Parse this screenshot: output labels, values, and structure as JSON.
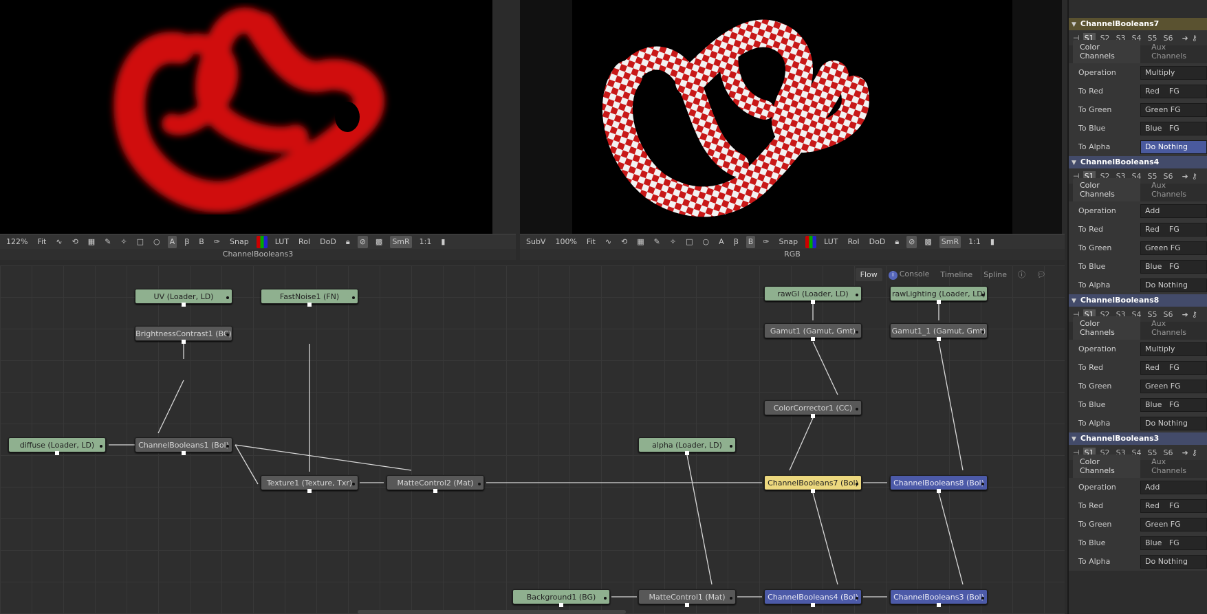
{
  "left_viewer": {
    "zoom": "122%",
    "fit": "Fit",
    "snap": "Snap",
    "lut": "LUT",
    "roi": "RoI",
    "dod": "DoD",
    "smr": "SmR",
    "ratio": "1:1",
    "label": "ChannelBooleans3"
  },
  "right_viewer": {
    "subv": "SubV",
    "zoom": "100%",
    "fit": "Fit",
    "snap": "Snap",
    "lut": "LUT",
    "roi": "RoI",
    "dod": "DoD",
    "smr": "SmR",
    "ratio": "1:1",
    "label": "RGB"
  },
  "flow_tabs": [
    "Flow",
    "Console",
    "Timeline",
    "Spline"
  ],
  "nodes": {
    "uv": "UV  (Loader, LD)",
    "fastnoise": "FastNoise1  (FN)",
    "brightness": "BrightnessContrast1  (BC)",
    "diffuse": "diffuse  (Loader, LD)",
    "cb1": "ChannelBooleans1  (Bol)",
    "texture": "Texture1  (Texture, Txr)",
    "matte2": "MatteControl2  (Mat)",
    "rawgi": "rawGI  (Loader, LD)",
    "rawlighting": "rawLighting  (Loader, LD)",
    "gamut1": "Gamut1  (Gamut, Gmt)",
    "gamut1_1": "Gamut1_1  (Gamut, Gmt)",
    "cc1": "ColorCorrector1  (CC)",
    "alpha": "alpha  (Loader, LD)",
    "cb7": "ChannelBooleans7  (Bol)",
    "cb8": "ChannelBooleans8  (Bol)",
    "bg": "Background1  (BG)",
    "matte1": "MatteControl1  (Mat)",
    "cb4": "ChannelBooleans4  (Bol)",
    "cb3": "ChannelBooleans3  (Bol)"
  },
  "panel": {
    "sections": [
      {
        "title": "ChannelBooleans7",
        "active": true,
        "operation": "Multiply",
        "to_red": "Red    FG",
        "to_green": "Green FG",
        "to_blue": "Blue   FG",
        "to_alpha": "Do Nothing",
        "alpha_selected": true
      },
      {
        "title": "ChannelBooleans4",
        "active": false,
        "operation": "Add",
        "to_red": "Red    FG",
        "to_green": "Green FG",
        "to_blue": "Blue   FG",
        "to_alpha": "Do Nothing",
        "alpha_selected": false
      },
      {
        "title": "ChannelBooleans8",
        "active": false,
        "operation": "Multiply",
        "to_red": "Red    FG",
        "to_green": "Green FG",
        "to_blue": "Blue   FG",
        "to_alpha": "Do Nothing",
        "alpha_selected": false
      },
      {
        "title": "ChannelBooleans3",
        "active": false,
        "operation": "Add",
        "to_red": "Red    FG",
        "to_green": "Green FG",
        "to_blue": "Blue   FG",
        "to_alpha": "Do Nothing",
        "alpha_selected": false
      }
    ],
    "slots": [
      "S1",
      "S2",
      "S3",
      "S4",
      "S5",
      "S6"
    ],
    "tab_color": "Color Channels",
    "tab_aux": "Aux Channels",
    "labels": {
      "operation": "Operation",
      "to_red": "To Red",
      "to_green": "To Green",
      "to_blue": "To Blue",
      "to_alpha": "To Alpha"
    }
  }
}
